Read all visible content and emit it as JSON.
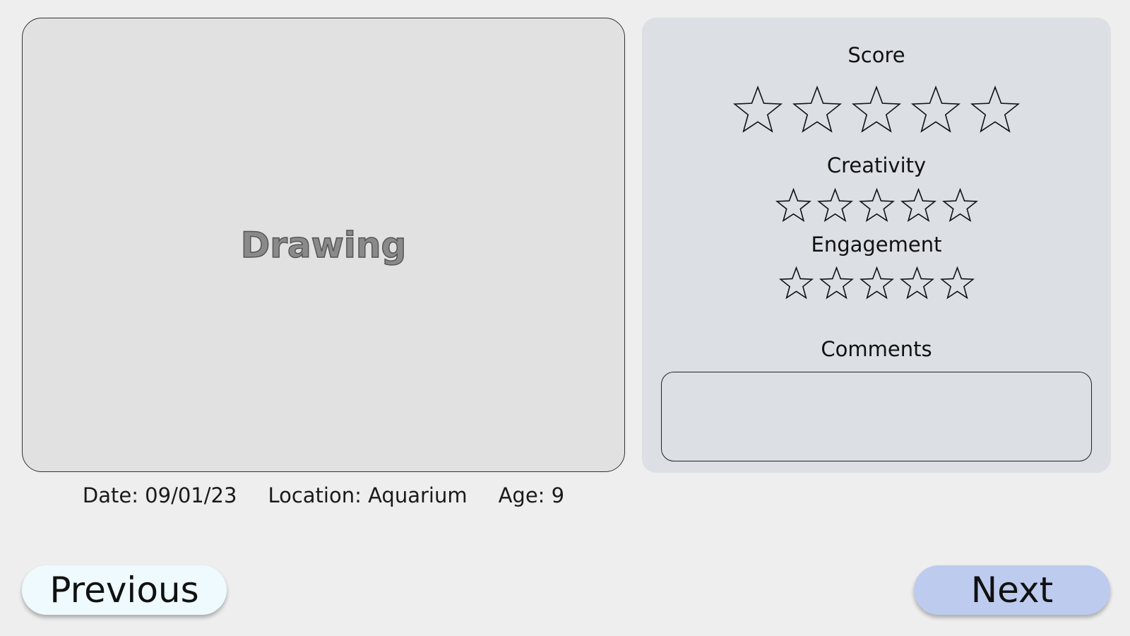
{
  "drawing": {
    "label": "Drawing"
  },
  "meta": {
    "date": "Date: 09/01/23",
    "location": "Location: Aquarium",
    "age": "Age: 9"
  },
  "ratings": {
    "score": {
      "label": "Score",
      "max_stars": 5,
      "filled": 0
    },
    "creativity": {
      "label": "Creativity",
      "max_stars": 5,
      "filled": 0
    },
    "engagement": {
      "label": "Engagement",
      "max_stars": 5,
      "filled": 0
    }
  },
  "comments": {
    "label": "Comments",
    "value": "",
    "placeholder": ""
  },
  "nav": {
    "previous_label": "Previous",
    "next_label": "Next"
  },
  "colors": {
    "background": "#eeeeee",
    "drawing_panel": "#e1e1e1",
    "rating_panel": "#dcdfe4",
    "previous_button": "#eefafd",
    "next_button": "#bccbee"
  },
  "icons": {
    "star": "star-outline-icon"
  }
}
